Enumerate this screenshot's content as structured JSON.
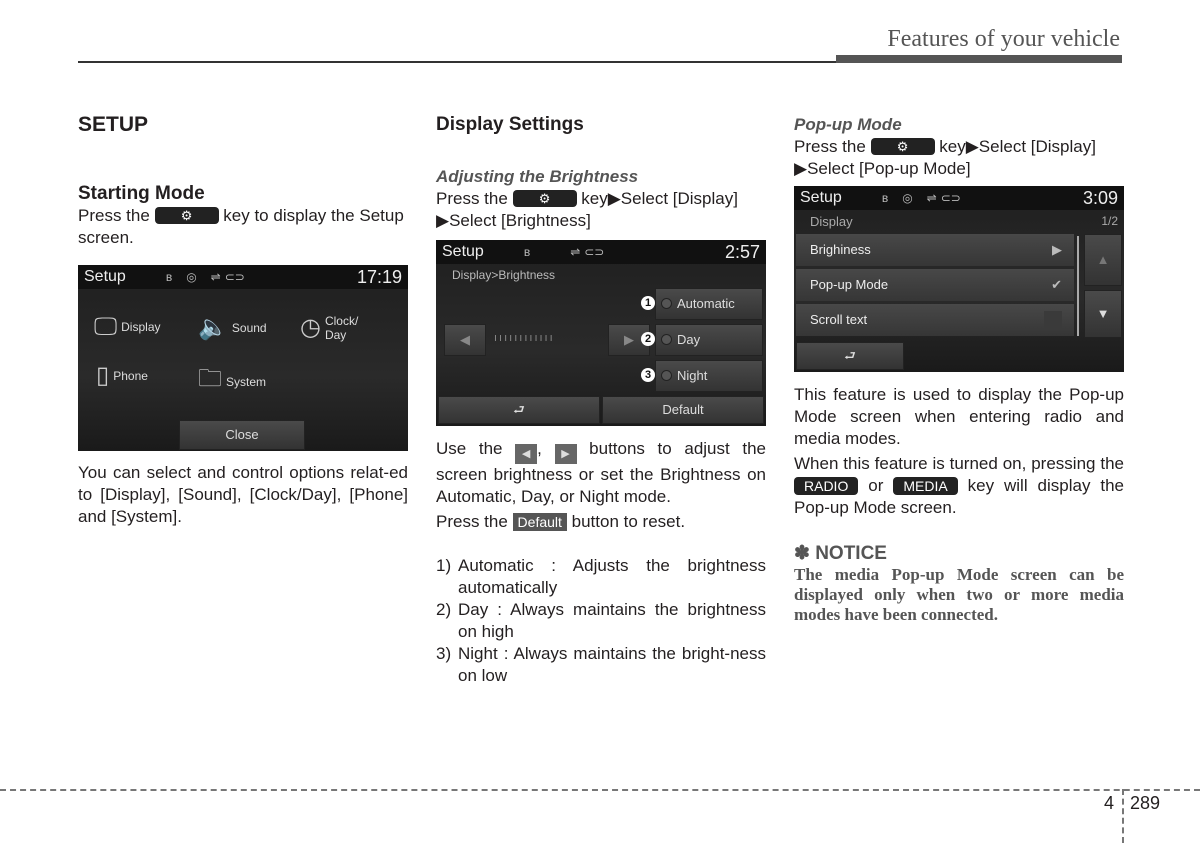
{
  "header": {
    "title": "Features of your vehicle"
  },
  "col1": {
    "title": "SETUP",
    "subtitle": "Starting Mode",
    "press_pre": "Press the",
    "press_post": "key to display the Setup screen.",
    "screen": {
      "title": "Setup",
      "time": "17:19",
      "status_icons": [
        "bluetooth-icon",
        "disc-icon",
        "usb-icon",
        "aux-icon"
      ],
      "tiles": [
        {
          "label": "Display",
          "icon": "display-settings-icon"
        },
        {
          "label": "Sound",
          "icon": "speaker-icon"
        },
        {
          "label": "Clock/ Day",
          "icon": "clock-icon"
        },
        {
          "label": "Phone",
          "icon": "phone-icon"
        },
        {
          "label": "System",
          "icon": "system-folder-icon"
        }
      ],
      "close": "Close"
    },
    "body": "You can select and control options relat-ed to [Display], [Sound], [Clock/Day], [Phone] and [System]."
  },
  "col2": {
    "title": "Display Settings",
    "subtitle": "Adjusting the Brightness",
    "press_pre": "Press the",
    "press_post": "key▶Select [Display] ▶Select [Brightness]",
    "screen": {
      "title": "Setup",
      "time": "2:57",
      "breadcrumb": "Display>Brightness",
      "options": [
        {
          "n": "1",
          "label": "Automatic"
        },
        {
          "n": "2",
          "label": "Day"
        },
        {
          "n": "3",
          "label": "Night"
        }
      ],
      "back": "⮐",
      "default": "Default"
    },
    "use_pre": "Use the",
    "use_mid": ",",
    "use_post": "buttons to adjust the screen brightness or set the Brightness on Automatic, Day, or Night mode.",
    "reset_pre": "Press the",
    "reset_btn": "Default",
    "reset_post": "button to reset.",
    "list": [
      {
        "n": "1)",
        "text": "Automatic : Adjusts the brightness automatically"
      },
      {
        "n": "2)",
        "text": "Day : Always maintains the brightness on high"
      },
      {
        "n": "3)",
        "text": "Night : Always maintains the bright-ness on low"
      }
    ]
  },
  "col3": {
    "subtitle": "Pop-up Mode",
    "press_pre": "Press the",
    "press_post": "key▶Select [Display] ▶Select [Pop-up Mode]",
    "screen": {
      "title": "Setup",
      "time": "3:09",
      "section": "Display",
      "page": "1/2",
      "rows": [
        {
          "label": "Brighiness",
          "right": "▶"
        },
        {
          "label": "Pop-up Mode",
          "right": "✔"
        },
        {
          "label": "Scroll text",
          "right": ""
        }
      ]
    },
    "para1": "This feature is used to display the Pop-up Mode screen when entering radio and media modes.",
    "para2_pre": "When this feature is turned on, pressing the",
    "radio": "RADIO",
    "or": "or",
    "media": "MEDIA",
    "para2_post": "key will display the Pop-up Mode screen.",
    "notice_title": "✽ NOTICE",
    "notice_body": "The media Pop-up Mode screen can be displayed only when two or more media modes have been connected."
  },
  "footer": {
    "section": "4",
    "page": "289"
  }
}
